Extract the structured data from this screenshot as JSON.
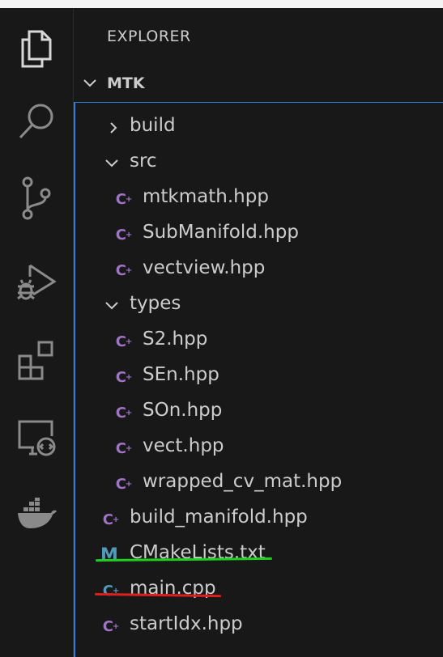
{
  "explorer": {
    "title": "EXPLORER",
    "folder_name": "MTK"
  },
  "activity_icons": [
    "files-icon",
    "search-icon",
    "source-control-icon",
    "run-debug-icon",
    "extensions-icon",
    "remote-explorer-icon",
    "docker-icon"
  ],
  "tree": [
    {
      "label": "build",
      "kind": "folder",
      "expanded": false,
      "depth": 1
    },
    {
      "label": "src",
      "kind": "folder",
      "expanded": true,
      "depth": 1
    },
    {
      "label": "mtkmath.hpp",
      "kind": "cpp",
      "depth": 2
    },
    {
      "label": "SubManifold.hpp",
      "kind": "cpp",
      "depth": 2
    },
    {
      "label": "vectview.hpp",
      "kind": "cpp",
      "depth": 2
    },
    {
      "label": "types",
      "kind": "folder",
      "expanded": true,
      "depth": 1
    },
    {
      "label": "S2.hpp",
      "kind": "cpp",
      "depth": 2
    },
    {
      "label": "SEn.hpp",
      "kind": "cpp",
      "depth": 2
    },
    {
      "label": "SOn.hpp",
      "kind": "cpp",
      "depth": 2
    },
    {
      "label": "vect.hpp",
      "kind": "cpp",
      "depth": 2
    },
    {
      "label": "wrapped_cv_mat.hpp",
      "kind": "cpp",
      "depth": 2
    },
    {
      "label": "build_manifold.hpp",
      "kind": "cpp",
      "depth": 1
    },
    {
      "label": "CMakeLists.txt",
      "kind": "cmake",
      "depth": 1
    },
    {
      "label": "main.cpp",
      "kind": "cpp-source",
      "depth": 1
    },
    {
      "label": "startIdx.hpp",
      "kind": "cpp",
      "depth": 1
    }
  ],
  "colors": {
    "accent_border": "#2f7fd8",
    "header_icon": "#a074c4",
    "source_icon": "#519aba",
    "annotation_green": "#1ed01e",
    "annotation_red": "#e01e1e"
  }
}
